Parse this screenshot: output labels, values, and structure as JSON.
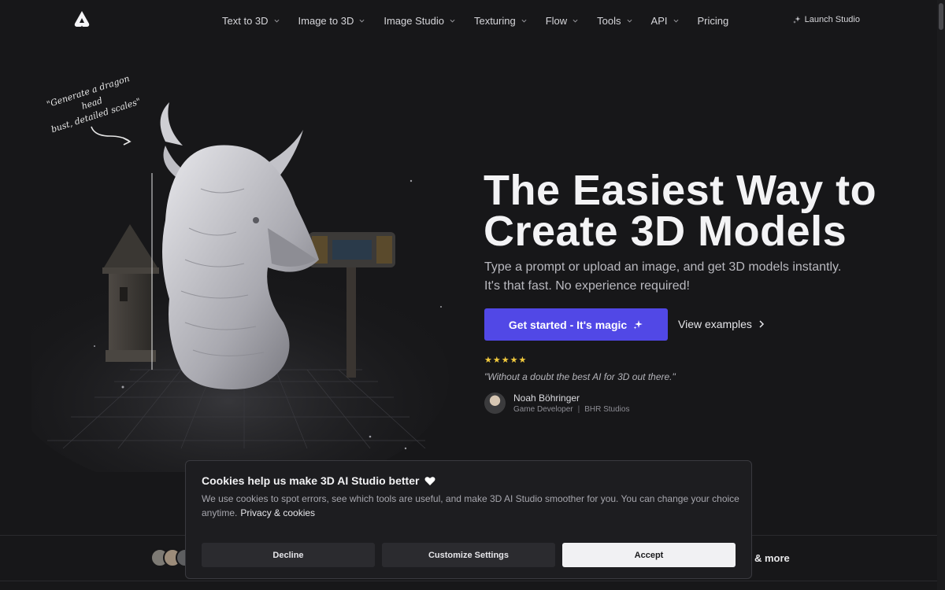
{
  "nav": {
    "items": [
      {
        "label": "Text to 3D",
        "dropdown": true
      },
      {
        "label": "Image to 3D",
        "dropdown": true
      },
      {
        "label": "Image Studio",
        "dropdown": true
      },
      {
        "label": "Texturing",
        "dropdown": true
      },
      {
        "label": "Flow",
        "dropdown": true
      },
      {
        "label": "Tools",
        "dropdown": true
      },
      {
        "label": "API",
        "dropdown": true
      },
      {
        "label": "Pricing",
        "dropdown": false
      }
    ],
    "launch_label": "Launch Studio"
  },
  "hero": {
    "annotation_line1": "\"Generate a dragon head",
    "annotation_line2": "bust, detailed scales\"",
    "title_line1": "The Easiest Way to",
    "title_line2": "Create 3D Models",
    "subtitle": "Type a prompt or upload an image, and get 3D models instantly. It's that fast. No experience required!",
    "cta_primary": "Get started - It's magic",
    "cta_secondary": "View examples",
    "rating": "★★★★★",
    "quote": "\"Without a doubt the best AI for 3D out there.\"",
    "reviewer_name": "Noah Böhringer",
    "reviewer_role": "Game Developer",
    "reviewer_company": "BHR Studios"
  },
  "strip": {
    "more_label": "& more"
  },
  "cookie": {
    "title": "Cookies help us make 3D AI Studio better",
    "text": "We use cookies to spot errors, see which tools are useful, and make 3D AI Studio smoother for you. You can change your choice anytime.",
    "link": "Privacy & cookies",
    "decline": "Decline",
    "customize": "Customize Settings",
    "accept": "Accept"
  },
  "colors": {
    "background": "#171719",
    "accent": "#5148e6",
    "stars": "#f3cb3d"
  },
  "icons": [
    "logo-icon",
    "chevron-down-icon",
    "sparkle-icon",
    "chevron-right-icon",
    "heart-icon"
  ]
}
